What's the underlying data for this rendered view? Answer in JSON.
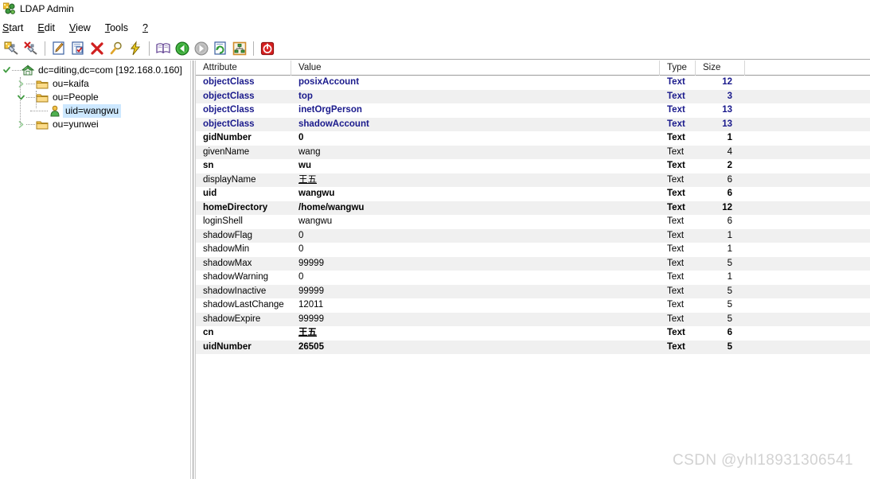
{
  "window": {
    "title": "LDAP Admin",
    "app_icon": "ldap-admin-icon"
  },
  "menubar": {
    "items": [
      {
        "label": "Start",
        "accel": "S",
        "clipped": true
      },
      {
        "label": "Edit",
        "accel": "E"
      },
      {
        "label": "View",
        "accel": "V"
      },
      {
        "label": "Tools",
        "accel": "T"
      },
      {
        "label": "?",
        "accel": "?"
      }
    ]
  },
  "toolbar": {
    "buttons": [
      {
        "name": "connect-icon",
        "title": "Connect"
      },
      {
        "name": "disconnect-icon",
        "title": "Disconnect"
      },
      {
        "name": "separator-1",
        "title": ""
      },
      {
        "name": "edit-entry-icon",
        "title": "Edit entry"
      },
      {
        "name": "new-entry-icon",
        "title": "New entry"
      },
      {
        "name": "delete-entry-icon",
        "title": "Delete entry"
      },
      {
        "name": "search-icon",
        "title": "Search"
      },
      {
        "name": "run-action-icon",
        "title": "Actions"
      },
      {
        "name": "separator-2",
        "title": ""
      },
      {
        "name": "schema-book-icon",
        "title": "Schema"
      },
      {
        "name": "back-arrow-icon",
        "title": "Back"
      },
      {
        "name": "forward-arrow-icon",
        "title": "Forward"
      },
      {
        "name": "refresh-icon",
        "title": "Refresh"
      },
      {
        "name": "tree-view-icon",
        "title": "Tree"
      },
      {
        "name": "separator-3",
        "title": ""
      },
      {
        "name": "exit-icon",
        "title": "Exit"
      }
    ]
  },
  "tree": {
    "nodes": [
      {
        "label": "dc=diting,dc=com [192.168.0.160]",
        "icon": "home-icon",
        "depth": 0,
        "expanded": true,
        "selected": false
      },
      {
        "label": "ou=kaifa",
        "icon": "folder-icon",
        "depth": 1,
        "expanded": false,
        "selected": false
      },
      {
        "label": "ou=People",
        "icon": "folder-icon",
        "depth": 1,
        "expanded": true,
        "selected": false
      },
      {
        "label": "uid=wangwu",
        "icon": "person-icon",
        "depth": 2,
        "expanded": null,
        "selected": true
      },
      {
        "label": "ou=yunwei",
        "icon": "folder-icon",
        "depth": 1,
        "expanded": false,
        "selected": false
      }
    ]
  },
  "list": {
    "columns": [
      "Attribute",
      "Value",
      "Type",
      "Size"
    ],
    "rows": [
      {
        "attribute": "objectClass",
        "value": "posixAccount",
        "type": "Text",
        "size": "12",
        "bold": true,
        "objectclass": true,
        "underline": false
      },
      {
        "attribute": "objectClass",
        "value": "top",
        "type": "Text",
        "size": "3",
        "bold": true,
        "objectclass": true,
        "underline": false
      },
      {
        "attribute": "objectClass",
        "value": "inetOrgPerson",
        "type": "Text",
        "size": "13",
        "bold": true,
        "objectclass": true,
        "underline": false
      },
      {
        "attribute": "objectClass",
        "value": "shadowAccount",
        "type": "Text",
        "size": "13",
        "bold": true,
        "objectclass": true,
        "underline": false
      },
      {
        "attribute": "gidNumber",
        "value": "0",
        "type": "Text",
        "size": "1",
        "bold": true,
        "objectclass": false,
        "underline": false
      },
      {
        "attribute": "givenName",
        "value": "wang",
        "type": "Text",
        "size": "4",
        "bold": false,
        "objectclass": false,
        "underline": false
      },
      {
        "attribute": "sn",
        "value": "wu",
        "type": "Text",
        "size": "2",
        "bold": true,
        "objectclass": false,
        "underline": false
      },
      {
        "attribute": "displayName",
        "value": "王五",
        "type": "Text",
        "size": "6",
        "bold": false,
        "objectclass": false,
        "underline": true
      },
      {
        "attribute": "uid",
        "value": "wangwu",
        "type": "Text",
        "size": "6",
        "bold": true,
        "objectclass": false,
        "underline": false
      },
      {
        "attribute": "homeDirectory",
        "value": "/home/wangwu",
        "type": "Text",
        "size": "12",
        "bold": true,
        "objectclass": false,
        "underline": false
      },
      {
        "attribute": "loginShell",
        "value": "wangwu",
        "type": "Text",
        "size": "6",
        "bold": false,
        "objectclass": false,
        "underline": false
      },
      {
        "attribute": "shadowFlag",
        "value": "0",
        "type": "Text",
        "size": "1",
        "bold": false,
        "objectclass": false,
        "underline": false
      },
      {
        "attribute": "shadowMin",
        "value": "0",
        "type": "Text",
        "size": "1",
        "bold": false,
        "objectclass": false,
        "underline": false
      },
      {
        "attribute": "shadowMax",
        "value": "99999",
        "type": "Text",
        "size": "5",
        "bold": false,
        "objectclass": false,
        "underline": false
      },
      {
        "attribute": "shadowWarning",
        "value": "0",
        "type": "Text",
        "size": "1",
        "bold": false,
        "objectclass": false,
        "underline": false
      },
      {
        "attribute": "shadowInactive",
        "value": "99999",
        "type": "Text",
        "size": "5",
        "bold": false,
        "objectclass": false,
        "underline": false
      },
      {
        "attribute": "shadowLastChange",
        "value": "12011",
        "type": "Text",
        "size": "5",
        "bold": false,
        "objectclass": false,
        "underline": false
      },
      {
        "attribute": "shadowExpire",
        "value": "99999",
        "type": "Text",
        "size": "5",
        "bold": false,
        "objectclass": false,
        "underline": false
      },
      {
        "attribute": "cn",
        "value": "王五",
        "type": "Text",
        "size": "6",
        "bold": true,
        "objectclass": false,
        "underline": true
      },
      {
        "attribute": "uidNumber",
        "value": "26505",
        "type": "Text",
        "size": "5",
        "bold": true,
        "objectclass": false,
        "underline": false
      }
    ]
  },
  "watermark": {
    "text": "CSDN @yhl18931306541"
  },
  "colors": {
    "objectclass_text": "#1a1a8c",
    "selection": "#cde8ff",
    "row_alt": "#f0f0f0",
    "watermark": "#d2d2d2"
  }
}
